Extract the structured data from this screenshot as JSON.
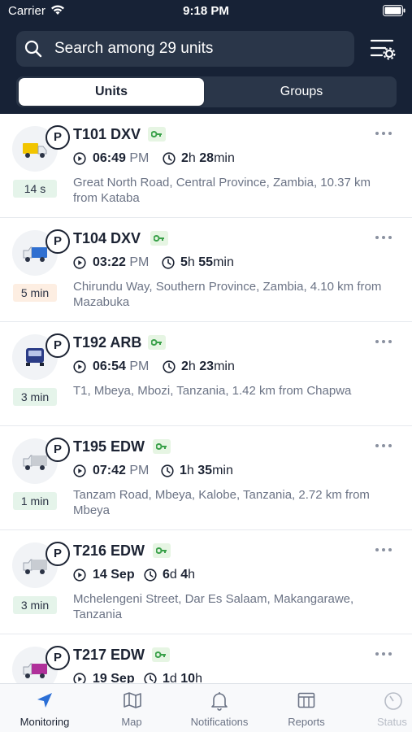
{
  "status_bar": {
    "carrier": "Carrier",
    "time": "9:18 PM"
  },
  "search": {
    "placeholder": "Search among 29 units"
  },
  "segments": {
    "units": "Units",
    "groups": "Groups"
  },
  "colors": {
    "header": "#172236",
    "accent": "#2b6fd6",
    "key_green": "#3aa14a",
    "age_green_bg": "#e5f4ea",
    "age_orange_bg": "#fdeee2"
  },
  "units": [
    {
      "name": "T101 DXV",
      "time": "06:49",
      "ampm": "PM",
      "dur_h": "2",
      "dur_h_unit": "h",
      "dur_m": "28",
      "dur_m_unit": "min",
      "address": "Great North Road, Central Province, Zambia, 10.37 km from Kataba",
      "age": "14 s",
      "truck_color": "#f2c500",
      "parked": "P"
    },
    {
      "name": "T104 DXV",
      "time": "03:22",
      "ampm": "PM",
      "dur_h": "5",
      "dur_h_unit": "h",
      "dur_m": "55",
      "dur_m_unit": "min",
      "address": "Chirundu Way, Southern Province, Zambia, 4.10 km from Mazabuka",
      "age": "5 min",
      "truck_color": "#2f6fd0",
      "parked": "P"
    },
    {
      "name": "T192 ARB",
      "time": "06:54",
      "ampm": "PM",
      "dur_h": "2",
      "dur_h_unit": "h",
      "dur_m": "23",
      "dur_m_unit": "min",
      "address": "T1, Mbeya, Mbozi, Tanzania, 1.42 km from Chapwa",
      "age": "3 min",
      "truck_color": "#2b3c86",
      "parked": "P"
    },
    {
      "name": "T195 EDW",
      "time": "07:42",
      "ampm": "PM",
      "dur_h": "1",
      "dur_h_unit": "h",
      "dur_m": "35",
      "dur_m_unit": "min",
      "address": "Tanzam Road, Mbeya, Kalobe, Tanzania, 2.72 km from Mbeya",
      "age": "1 min",
      "truck_color": "#c8ccd2",
      "parked": "P"
    },
    {
      "name": "T216 EDW",
      "time": "14 Sep",
      "ampm": "",
      "dur_h": "6",
      "dur_h_unit": "d",
      "dur_m": "4",
      "dur_m_unit": "h",
      "address": "Mchelengeni Street, Dar Es Salaam, Makangarawe, Tanzania",
      "age": "3 min",
      "truck_color": "#c8ccd2",
      "parked": "P"
    },
    {
      "name": "T217 EDW",
      "time": "19 Sep",
      "ampm": "",
      "dur_h": "1",
      "dur_h_unit": "d",
      "dur_m": "10",
      "dur_m_unit": "h",
      "address": "",
      "age": "",
      "truck_color": "#b0309a",
      "parked": "P"
    }
  ],
  "tabs": [
    {
      "label": "Monitoring",
      "icon": "navigation-arrow-icon"
    },
    {
      "label": "Map",
      "icon": "map-icon"
    },
    {
      "label": "Notifications",
      "icon": "bell-icon"
    },
    {
      "label": "Reports",
      "icon": "reports-icon"
    },
    {
      "label": "Status",
      "icon": "status-gauge-icon"
    }
  ]
}
